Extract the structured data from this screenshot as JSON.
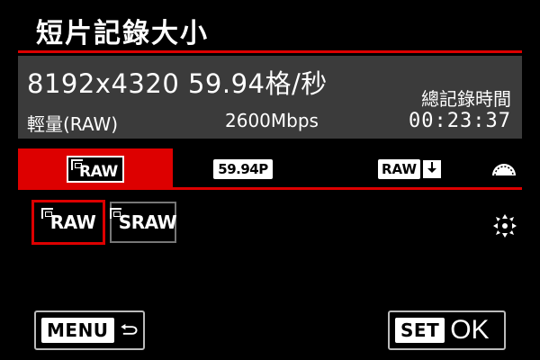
{
  "screen": {
    "title": "短片記錄大小"
  },
  "info": {
    "resolution": "8192x4320 59.94格/秒",
    "quality": "輕量(RAW)",
    "bitrate": "2600Mbps",
    "total_label": "總記錄時間",
    "total_value": "00:23:37"
  },
  "tabs": [
    {
      "label": "RAW",
      "icon": "raw-film-icon",
      "selected": true
    },
    {
      "label": "59.94P",
      "icon": "frame-rate-icon",
      "selected": false
    },
    {
      "label": "RAW",
      "icon": "raw-save-card-icon",
      "selected": false
    },
    {
      "icon": "main-dial-icon"
    }
  ],
  "options": [
    {
      "label": "RAW",
      "icon": "raw-film-icon",
      "selected": true
    },
    {
      "label": "RAW",
      "prefix": "S",
      "selected": false
    }
  ],
  "multi_controller_icon": "multi-controller-icon",
  "buttons": {
    "menu_label": "MENU",
    "set_label": "SET",
    "ok_label": "OK"
  },
  "colors": {
    "accent": "#dd0000",
    "panel": "#3b3b3b",
    "background": "#000000"
  }
}
